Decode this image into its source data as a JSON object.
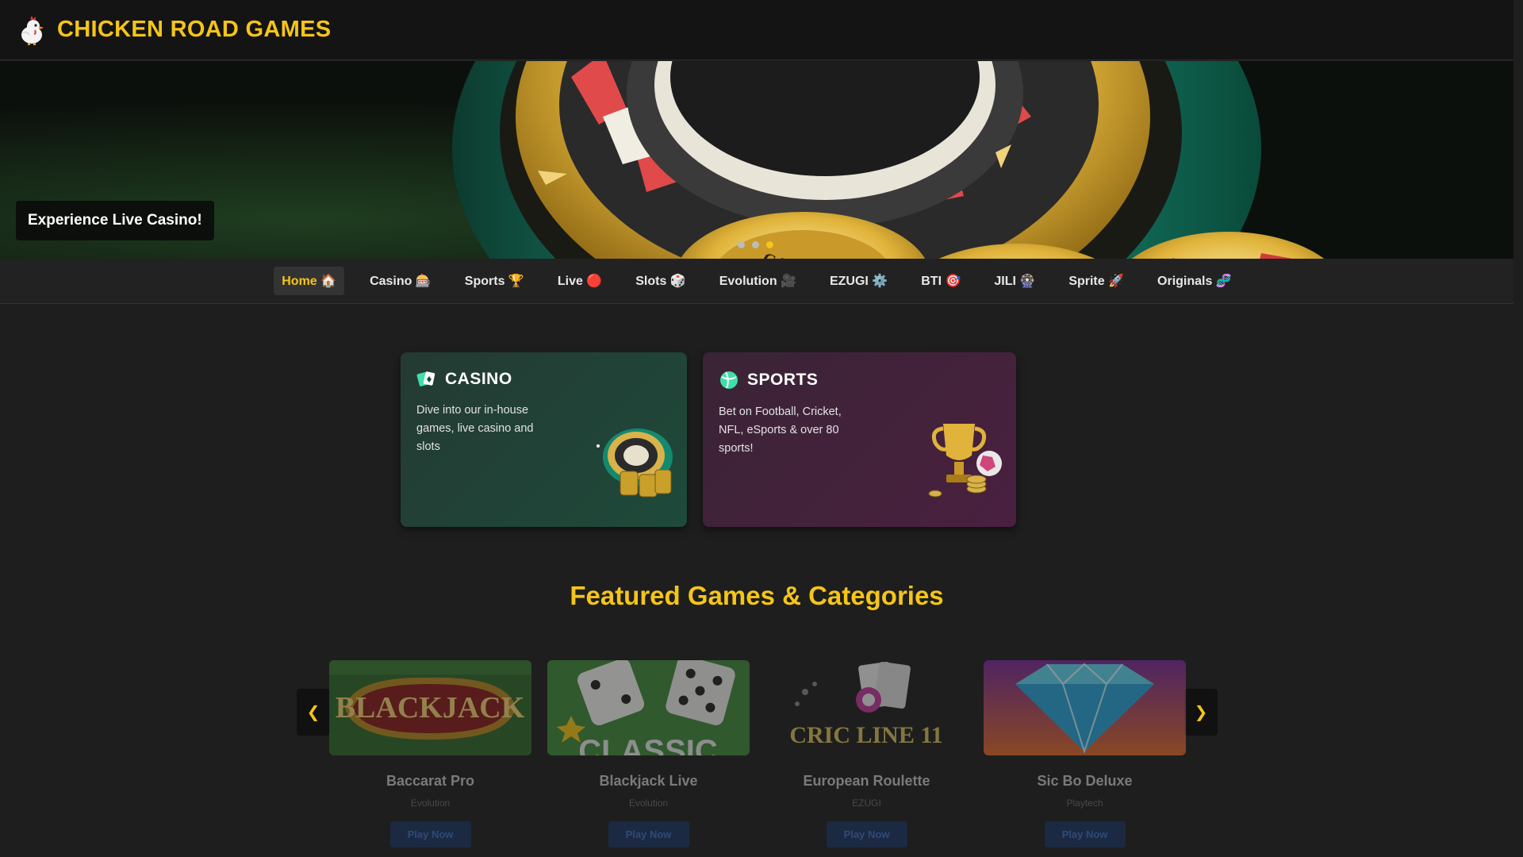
{
  "header": {
    "brand": "CHICKEN ROAD GAMES",
    "logo_icon": "chicken-logo-icon"
  },
  "hero": {
    "caption": "Experience Live Casino!",
    "slides": 3,
    "active_slide": 3
  },
  "nav": {
    "items": [
      {
        "label": "Home 🏠",
        "active": true
      },
      {
        "label": "Casino 🎰",
        "active": false
      },
      {
        "label": "Sports 🏆",
        "active": false
      },
      {
        "label": "Live 🔴",
        "active": false
      },
      {
        "label": "Slots 🎲",
        "active": false
      },
      {
        "label": "Evolution 🎥",
        "active": false
      },
      {
        "label": "EZUGI ⚙️",
        "active": false
      },
      {
        "label": "BTI 🎯",
        "active": false
      },
      {
        "label": "JILI 🎡",
        "active": false
      },
      {
        "label": "Sprite 🚀",
        "active": false
      },
      {
        "label": "Originals 🧬",
        "active": false
      }
    ]
  },
  "promos": {
    "casino": {
      "title": "CASINO",
      "description": "Dive into our in-house games, live casino and slots",
      "icon": "cards-icon"
    },
    "sports": {
      "title": "SPORTS",
      "description": "Bet on Football, Cricket, NFL, eSports & over 80 sports!",
      "icon": "ball-icon"
    }
  },
  "featured": {
    "title": "Featured Games & Categories",
    "prev_label": "❮",
    "next_label": "❯",
    "games": [
      {
        "title": "Baccarat Pro",
        "provider": "Evolution",
        "button": "Play Now",
        "thumb_text": "BLACKJACK"
      },
      {
        "title": "Blackjack Live",
        "provider": "Evolution",
        "button": "Play Now",
        "thumb_text": "CLASSIC"
      },
      {
        "title": "European Roulette",
        "provider": "EZUGI",
        "button": "Play Now",
        "thumb_text": "CRIC LINE 11"
      },
      {
        "title": "Sic Bo Deluxe",
        "provider": "Playtech",
        "button": "Play Now",
        "thumb_text": ""
      }
    ]
  },
  "colors": {
    "accent": "#f5c518",
    "header_bg": "#141414",
    "page_bg": "#1e1e1e"
  }
}
